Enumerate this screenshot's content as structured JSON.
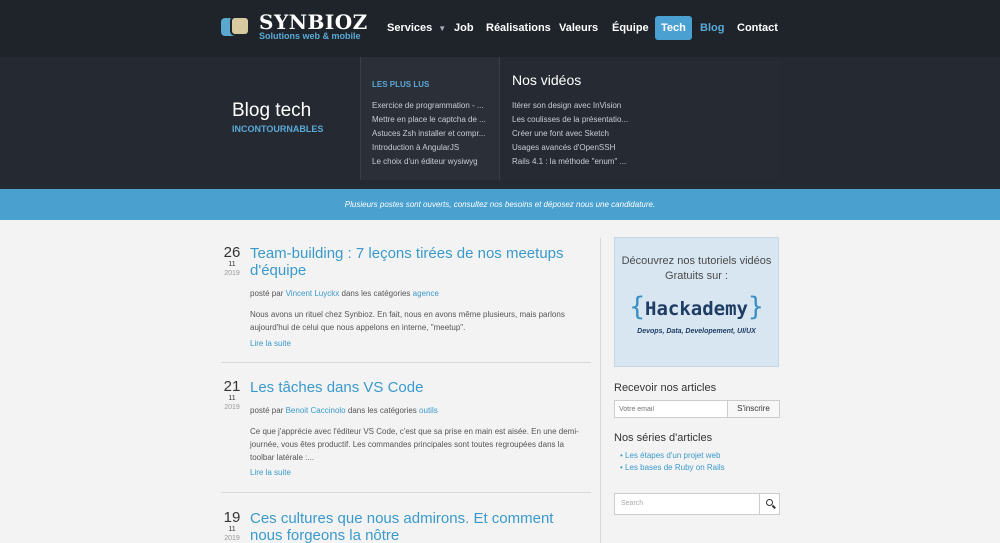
{
  "brand": {
    "name": "SYNBIOZ",
    "tagline": "Solutions web & mobile"
  },
  "nav": [
    {
      "label": "Services",
      "dropdown": true
    },
    {
      "label": "Job"
    },
    {
      "label": "Réalisations"
    },
    {
      "label": "Valeurs"
    },
    {
      "label": "Équipe"
    },
    {
      "label": "Tech",
      "active": true
    },
    {
      "label": "Blog",
      "current": true
    },
    {
      "label": "Contact"
    }
  ],
  "mega": {
    "title": "Blog tech",
    "subtitle": "INCONTOURNABLES",
    "popular_heading": "LES PLUS LUS",
    "popular": [
      "Exercice de programmation - ...",
      "Mettre en place le captcha de ...",
      "Astuces Zsh installer et compr...",
      "Introduction à AngularJS",
      "Le choix d'un éditeur wysiwyg"
    ],
    "videos_heading": "Nos vidéos",
    "videos": [
      "Itérer son design avec InVision",
      "Les coulisses de la présentatio...",
      "Créer une font avec Sketch",
      "Usages avancés d'OpenSSH",
      "Rails 4.1 : la méthode \"enum\" ..."
    ]
  },
  "banner": "Plusieurs postes sont ouverts, consultez nos besoins et déposez nous une candidature.",
  "posts": [
    {
      "day": "26",
      "month": "11",
      "year": "2019",
      "title": "Team-building : 7 leçons tirées de nos meetups d'équipe",
      "by": "posté par",
      "author": "Vincent Luyckx",
      "in": "dans les catégories",
      "category": "agence",
      "excerpt": "Nous avons un rituel chez Synbioz. En fait, nous en avons même plusieurs, mais parlons aujourd'hui de celui que nous appelons en interne, \"meetup\".",
      "more": "Lire la suite"
    },
    {
      "day": "21",
      "month": "11",
      "year": "2019",
      "title": "Les tâches dans VS Code",
      "by": "posté par",
      "author": "Benoit Caccinolo",
      "in": "dans les catégories",
      "category": "outils",
      "excerpt": "Ce que j'apprécie avec l'éditeur VS Code, c'est que sa prise en main est aisée. En une demi-journée, vous êtes productif. Les commandes principales sont toutes regroupées dans la toolbar latérale :...",
      "more": "Lire la suite"
    },
    {
      "day": "19",
      "month": "11",
      "year": "2019",
      "title": "Ces cultures que nous admirons. Et comment nous forgeons la nôtre"
    }
  ],
  "sidebar": {
    "promo_line": "Découvrez nos tutoriels vidéos Gratuits sur :",
    "promo_brand_open": "{",
    "promo_brand_name": "Hackademy",
    "promo_brand_close": "}",
    "promo_tags": "Devops, Data, Developement, UI/UX",
    "newsletter_heading": "Recevoir nos articles",
    "newsletter_placeholder": "Votre email",
    "newsletter_button": "S'inscrire",
    "series_heading": "Nos séries d'articles",
    "series": [
      "Les étapes d'un projet web",
      "Les bases de Ruby on Rails"
    ],
    "search_placeholder": "Search"
  }
}
